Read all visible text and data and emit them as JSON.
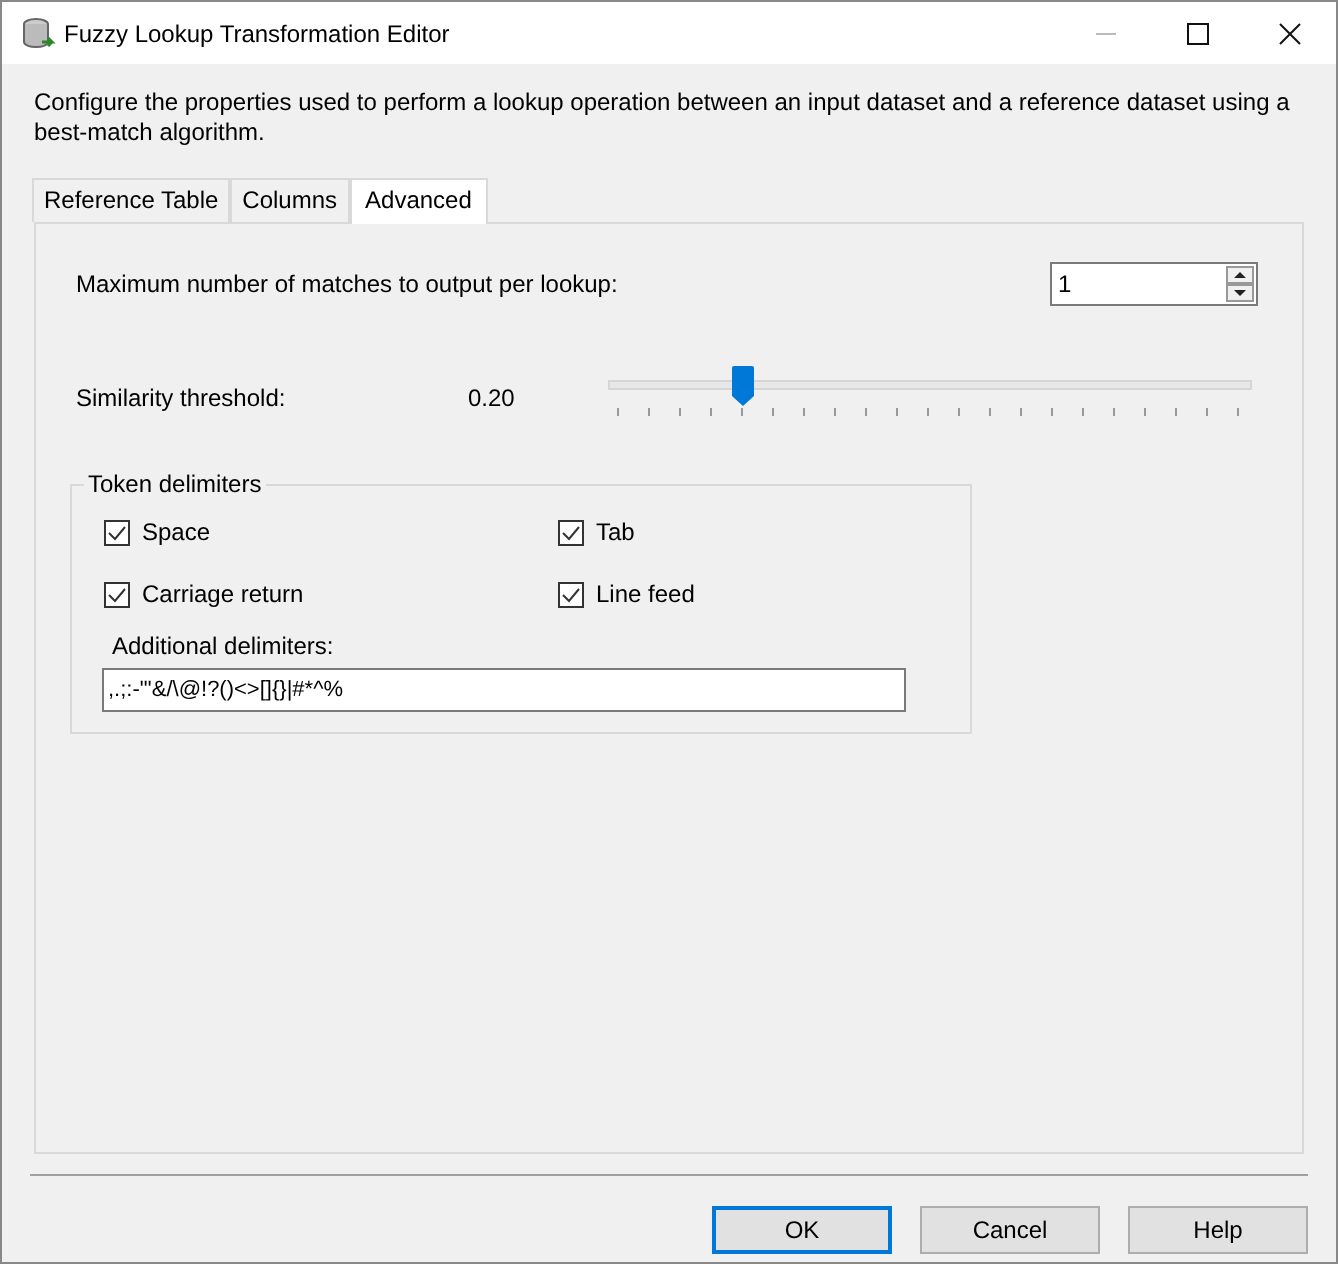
{
  "window": {
    "title": "Fuzzy Lookup Transformation Editor"
  },
  "description": "Configure the properties used to perform a lookup operation between an input dataset and a reference dataset using a best-match algorithm.",
  "tabs": [
    {
      "label": "Reference Table",
      "selected": false
    },
    {
      "label": "Columns",
      "selected": false
    },
    {
      "label": "Advanced",
      "selected": true
    }
  ],
  "max_matches": {
    "label": "Maximum number of matches to output per lookup:",
    "value": "1"
  },
  "similarity": {
    "label": "Similarity threshold:",
    "reading": "0.20",
    "level": 0.2
  },
  "token_delimiters": {
    "title": "Token delimiters",
    "checkboxes": [
      {
        "label": "Space",
        "checked": true
      },
      {
        "label": "Tab",
        "checked": true
      },
      {
        "label": "Carriage return",
        "checked": true
      },
      {
        "label": "Line feed",
        "checked": true
      }
    ],
    "additional_label": "Additional delimiters:",
    "additional_value": ",.;:-\"'&/\\@!?()<>[]{}|#*^%"
  },
  "buttons": [
    {
      "label": "OK",
      "default": true
    },
    {
      "label": "Cancel",
      "default": false
    },
    {
      "label": "Help",
      "default": false
    }
  ]
}
